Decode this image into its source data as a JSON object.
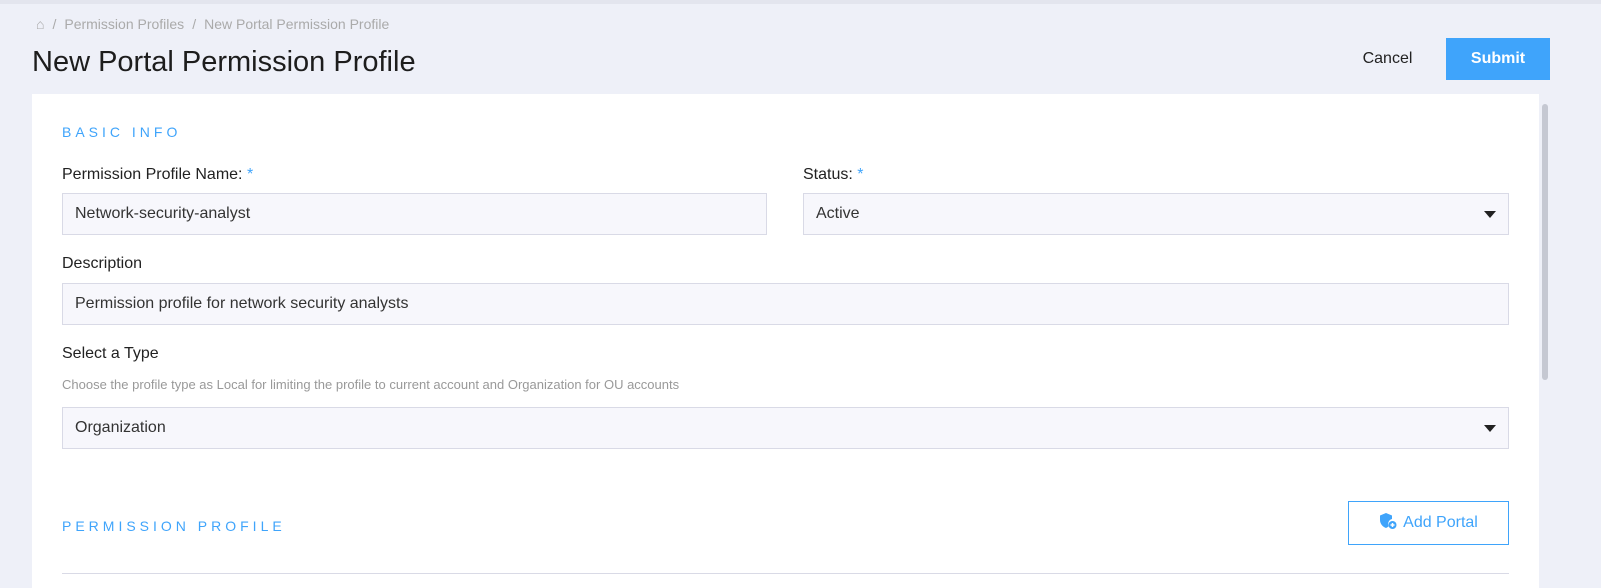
{
  "breadcrumb": {
    "items": [
      "Permission Profiles",
      "New Portal Permission Profile"
    ]
  },
  "page_title": "New Portal Permission Profile",
  "actions": {
    "cancel": "Cancel",
    "submit": "Submit"
  },
  "basic_info": {
    "section_title": "BASIC INFO",
    "name_label": "Permission Profile Name:",
    "name_value": "Network-security-analyst",
    "status_label": "Status:",
    "status_value": "Active",
    "required_mark": "*",
    "description_label": "Description",
    "description_value": "Permission profile for network security analysts",
    "type_label": "Select a Type",
    "type_help": "Choose the profile type as Local for limiting the profile to current account and Organization for OU accounts",
    "type_value": "Organization"
  },
  "permission_profile": {
    "section_title": "PERMISSION PROFILE",
    "add_portal": "Add Portal"
  }
}
